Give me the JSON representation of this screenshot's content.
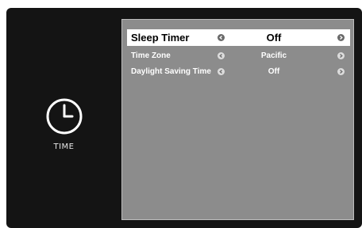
{
  "left_panel": {
    "icon": "clock-icon",
    "label": "TIME"
  },
  "menu": {
    "items": [
      {
        "label": "Sleep Timer",
        "value": "Off",
        "selected": true
      },
      {
        "label": "Time Zone",
        "value": "Pacific",
        "selected": false
      },
      {
        "label": "Daylight Saving Time",
        "value": "Off",
        "selected": false
      }
    ]
  },
  "colors": {
    "screen_background": "#141414",
    "menu_background": "#8c8c8c",
    "selected_row": "#ffffff"
  }
}
